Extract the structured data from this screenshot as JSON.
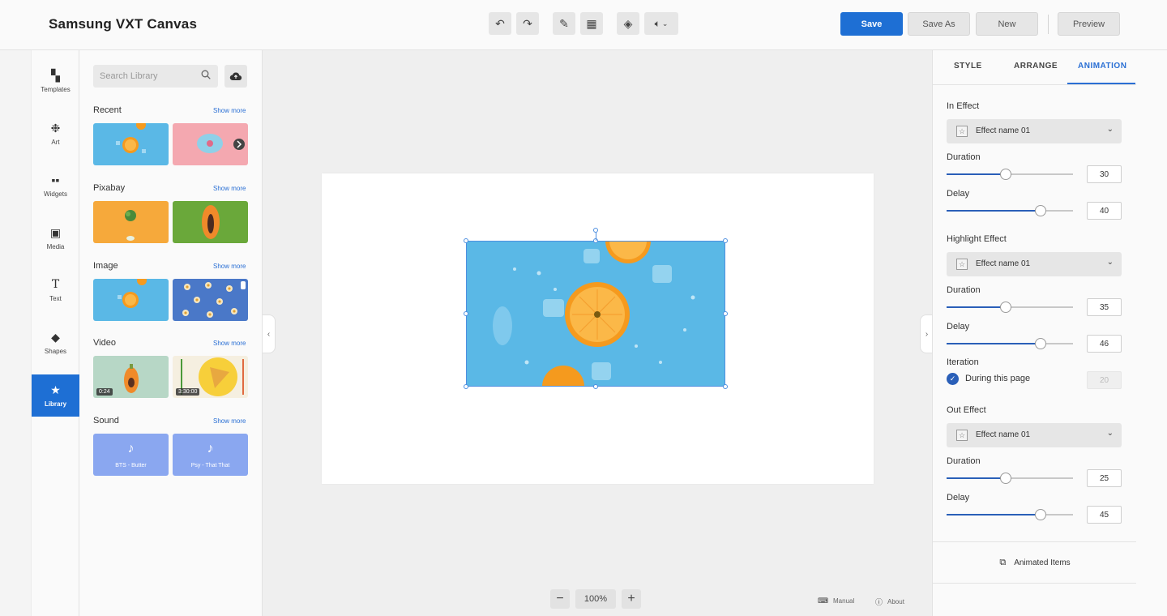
{
  "app": {
    "title": "Samsung VXT Canvas"
  },
  "toolbar": {
    "undo_icon": "undo-icon",
    "redo_icon": "redo-icon",
    "save_label": "Save",
    "save_as_label": "Save As",
    "new_label": "New",
    "preview_label": "Preview"
  },
  "rail": {
    "items": [
      {
        "label": "Templates",
        "icon": "templates-icon"
      },
      {
        "label": "Art",
        "icon": "art-icon"
      },
      {
        "label": "Widgets",
        "icon": "widgets-icon"
      },
      {
        "label": "Media",
        "icon": "media-icon"
      },
      {
        "label": "Text",
        "icon": "text-icon"
      },
      {
        "label": "Shapes",
        "icon": "shapes-icon"
      },
      {
        "label": "Library",
        "icon": "star-icon",
        "active": true
      }
    ]
  },
  "library": {
    "search_placeholder": "Search Library",
    "sections": [
      {
        "title": "Recent",
        "more": "Show more"
      },
      {
        "title": "Pixabay",
        "more": "Show more"
      },
      {
        "title": "Image",
        "more": "Show more"
      },
      {
        "title": "Video",
        "more": "Show more",
        "durations": [
          "0:24",
          "3:30:00"
        ]
      },
      {
        "title": "Sound",
        "more": "Show more",
        "tracks": [
          "BTS - Butter",
          "Psy - That That"
        ]
      }
    ]
  },
  "zoom": {
    "value": "100%",
    "minus": "−",
    "plus": "+"
  },
  "footer": {
    "manual": "Manual",
    "about": "About"
  },
  "props": {
    "tabs": [
      "STYLE",
      "ARRANGE",
      "ANIMATION"
    ],
    "active_tab": "ANIMATION",
    "in_effect": {
      "label": "In Effect",
      "effect": "Effect name 01",
      "duration_label": "Duration",
      "duration": "30",
      "delay_label": "Delay",
      "delay": "40"
    },
    "highlight_effect": {
      "label": "Highlight Effect",
      "effect": "Effect name 01",
      "duration_label": "Duration",
      "duration": "35",
      "delay_label": "Delay",
      "delay": "46",
      "iteration_label": "Iteration",
      "during_label": "During this page",
      "iteration": "20"
    },
    "out_effect": {
      "label": "Out Effect",
      "effect": "Effect name 01",
      "duration_label": "Duration",
      "duration": "25",
      "delay_label": "Delay",
      "delay": "45"
    },
    "animated_items": "Animated Items"
  },
  "colors": {
    "accent": "#1e6fd4",
    "sound_tile": "#8aa7f0",
    "image_bg": "#5ab8e6"
  }
}
